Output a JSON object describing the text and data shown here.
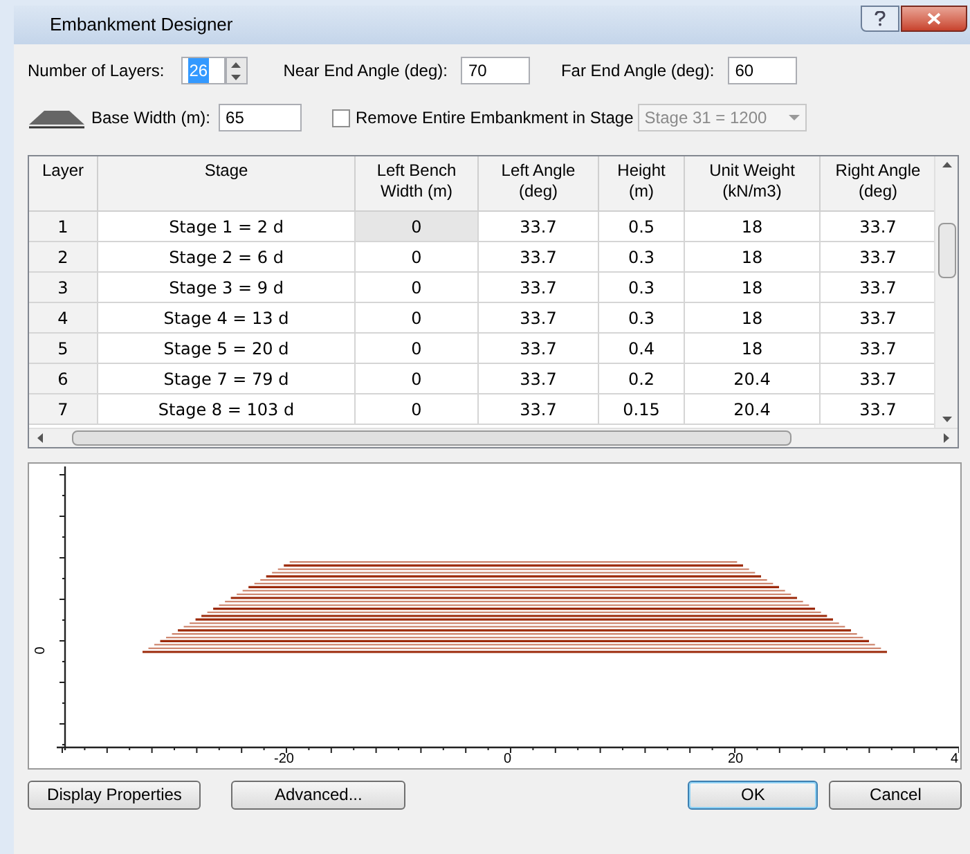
{
  "window": {
    "title": "Embankment Designer"
  },
  "fields": {
    "layers_label": "Number of Layers:",
    "layers_value": "26",
    "layers_value_highlighted": true,
    "near_label": "Near End Angle (deg):",
    "near_value": "70",
    "far_label": "Far End Angle (deg):",
    "far_value": "60",
    "base_label": "Base Width (m):",
    "base_value": "65"
  },
  "remove_stage": {
    "label": "Remove Entire Embankment in Stage",
    "checked": false,
    "value": "Stage 31 = 1200",
    "disabled": true
  },
  "table": {
    "columns": [
      "Layer",
      "Stage",
      "Left Bench Width (m)",
      "Left Angle (deg)",
      "Height (m)",
      "Unit Weight (kN/m3)",
      "Right Angle (deg)"
    ],
    "rows": [
      {
        "cells": [
          "1",
          "Stage 1 = 2 d",
          "0",
          "33.7",
          "0.5",
          "18",
          "33.7"
        ],
        "selected": true
      },
      {
        "cells": [
          "2",
          "Stage 2 = 6 d",
          "0",
          "33.7",
          "0.3",
          "18",
          "33.7"
        ],
        "selected": false
      },
      {
        "cells": [
          "3",
          "Stage 3 = 9 d",
          "0",
          "33.7",
          "0.3",
          "18",
          "33.7"
        ],
        "selected": false
      },
      {
        "cells": [
          "4",
          "Stage 4 = 13 d",
          "0",
          "33.7",
          "0.3",
          "18",
          "33.7"
        ],
        "selected": false
      },
      {
        "cells": [
          "5",
          "Stage 5 = 20 d",
          "0",
          "33.7",
          "0.4",
          "18",
          "33.7"
        ],
        "selected": false
      },
      {
        "cells": [
          "6",
          "Stage 7 = 79 d",
          "0",
          "33.7",
          "0.2",
          "20.4",
          "33.7"
        ],
        "selected": false
      },
      {
        "cells": [
          "7",
          "Stage 8 = 103 d",
          "0",
          "33.7",
          "0.15",
          "20.4",
          "33.7"
        ],
        "selected": false
      }
    ]
  },
  "plot": {
    "x_labels": [
      "-20",
      "0",
      "20",
      "4"
    ],
    "y_labels": [
      "0"
    ]
  },
  "buttons": [
    {
      "label": "Display Properties",
      "default": false
    },
    {
      "label": "Advanced...",
      "default": false
    },
    {
      "label": "OK",
      "default": true
    },
    {
      "label": "Cancel",
      "default": false
    }
  ]
}
